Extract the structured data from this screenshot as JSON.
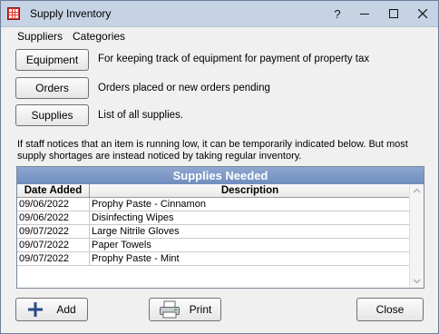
{
  "window": {
    "title": "Supply Inventory",
    "help_label": "?"
  },
  "menu": {
    "items": [
      "Suppliers",
      "Categories"
    ]
  },
  "sections": [
    {
      "button": "Equipment",
      "description": "For keeping track of equipment for payment of property tax"
    },
    {
      "button": "Orders",
      "description": "Orders placed or new orders pending"
    },
    {
      "button": "Supplies",
      "description": "List of all supplies."
    }
  ],
  "note": "If staff notices that an item is running low, it can be temporarily indicated below.  But most supply shortages are instead noticed by taking regular inventory.",
  "grid": {
    "title": "Supplies Needed",
    "columns": [
      "Date Added",
      "Description"
    ],
    "rows": [
      {
        "date": "09/06/2022",
        "description": "Prophy Paste - Cinnamon"
      },
      {
        "date": "09/06/2022",
        "description": "Disinfecting Wipes"
      },
      {
        "date": "09/07/2022",
        "description": "Large Nitrile Gloves"
      },
      {
        "date": "09/07/2022",
        "description": "Paper Towels"
      },
      {
        "date": "09/07/2022",
        "description": "Prophy Paste - Mint"
      }
    ]
  },
  "footer": {
    "add_label": "Add",
    "print_label": "Print",
    "close_label": "Close"
  },
  "colors": {
    "titlebar": "#c6d3e4",
    "grid_title": "#7a97c6",
    "app_icon": "#d9342b"
  }
}
